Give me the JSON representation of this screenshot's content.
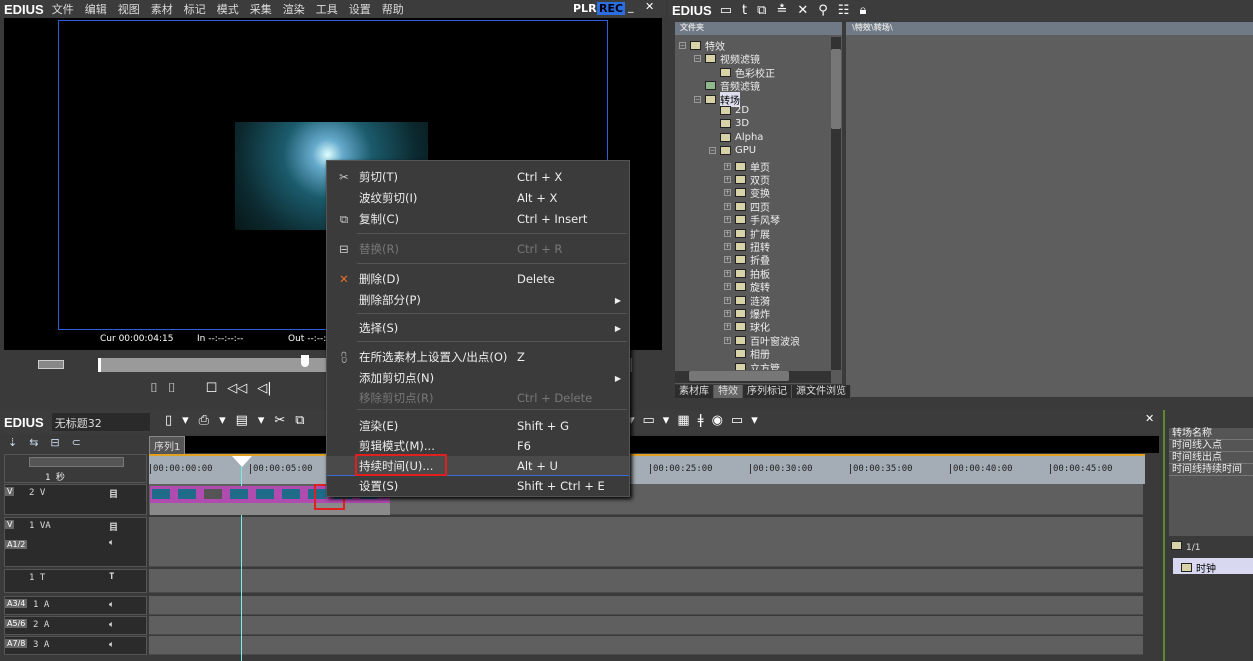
{
  "player": {
    "logo": "EDIUS",
    "menu": [
      "文件",
      "编辑",
      "视图",
      "素材",
      "标记",
      "模式",
      "采集",
      "渲染",
      "工具",
      "设置",
      "帮助"
    ],
    "plr": "PLR",
    "rec": "REC",
    "cur_label": "Cur",
    "cur": "00:00:04:15",
    "in_label": "In",
    "in": "--:--:--:--",
    "out_label": "Out",
    "out": "--:--:--:--"
  },
  "bin": {
    "logo": "EDIUS",
    "folder_header": "文件夹",
    "path": "\\特效\\转场\\",
    "tree": [
      "特效",
      "视频滤镜",
      "色彩校正",
      "音频滤镜",
      "转场",
      "2D",
      "3D",
      "Alpha",
      "GPU",
      "单页",
      "双页",
      "变换",
      "四页",
      "手风琴",
      "扩展",
      "扭转",
      "折叠",
      "拍板",
      "旋转",
      "涟漪",
      "爆炸",
      "球化",
      "百叶窗波浪",
      "相册",
      "立方管"
    ],
    "tabs": [
      "素材库",
      "特效",
      "序列标记",
      "源文件浏览"
    ]
  },
  "timeline": {
    "logo": "EDIUS",
    "project": "无标题32",
    "sequence_tab": "序列1",
    "scale": "1 秒",
    "ruler": [
      "00:00:00:00",
      "00:00:05:00",
      "00:00:25:00",
      "00:00:30:00",
      "00:00:35:00",
      "00:00:40:00",
      "00:00:45:00"
    ],
    "tracks": [
      {
        "name": "2 V",
        "icon": "目"
      },
      {
        "name": "1 VA",
        "icon": "目"
      },
      {
        "name": "1 T",
        "icon": "T"
      },
      {
        "name": "1 A"
      },
      {
        "name": "2 A"
      },
      {
        "name": "3 A"
      }
    ],
    "track_labels": {
      "v": "V",
      "a": "A",
      "a12": "A1/2",
      "a34": "A3/4",
      "a56": "A5/6",
      "a78": "A7/8"
    }
  },
  "info": {
    "rows": [
      "转场名称",
      "时间线入点",
      "时间线出点",
      "时间线持续时间"
    ],
    "page": "1/1",
    "item": "时钟"
  },
  "context_menu": [
    {
      "label": "剪切(T)",
      "shortcut": "Ctrl + X",
      "icon": "scissors-icon"
    },
    {
      "label": "波纹剪切(I)",
      "shortcut": "Alt + X"
    },
    {
      "label": "复制(C)",
      "shortcut": "Ctrl + Insert",
      "icon": "copy-icon"
    },
    {
      "label": "替换(R)",
      "shortcut": "Ctrl + R",
      "disabled": true,
      "icon": "replace-icon"
    },
    {
      "label": "删除(D)",
      "shortcut": "Delete",
      "icon": "delete-icon"
    },
    {
      "label": "删除部分(P)",
      "submenu": true
    },
    {
      "label": "选择(S)",
      "submenu": true
    },
    {
      "label": "在所选素材上设置入/出点(O)",
      "shortcut": "Z",
      "icon": "in-out-icon"
    },
    {
      "label": "添加剪切点(N)",
      "submenu": true
    },
    {
      "label": "移除剪切点(R)",
      "shortcut": "Ctrl + Delete",
      "disabled": true
    },
    {
      "label": "渲染(E)",
      "shortcut": "Shift + G"
    },
    {
      "label": "剪辑模式(M)...",
      "shortcut": "F6"
    },
    {
      "label": "持续时间(U)...",
      "shortcut": "Alt + U",
      "highlighted": true
    },
    {
      "label": "设置(S)",
      "shortcut": "Shift + Ctrl + E"
    }
  ]
}
